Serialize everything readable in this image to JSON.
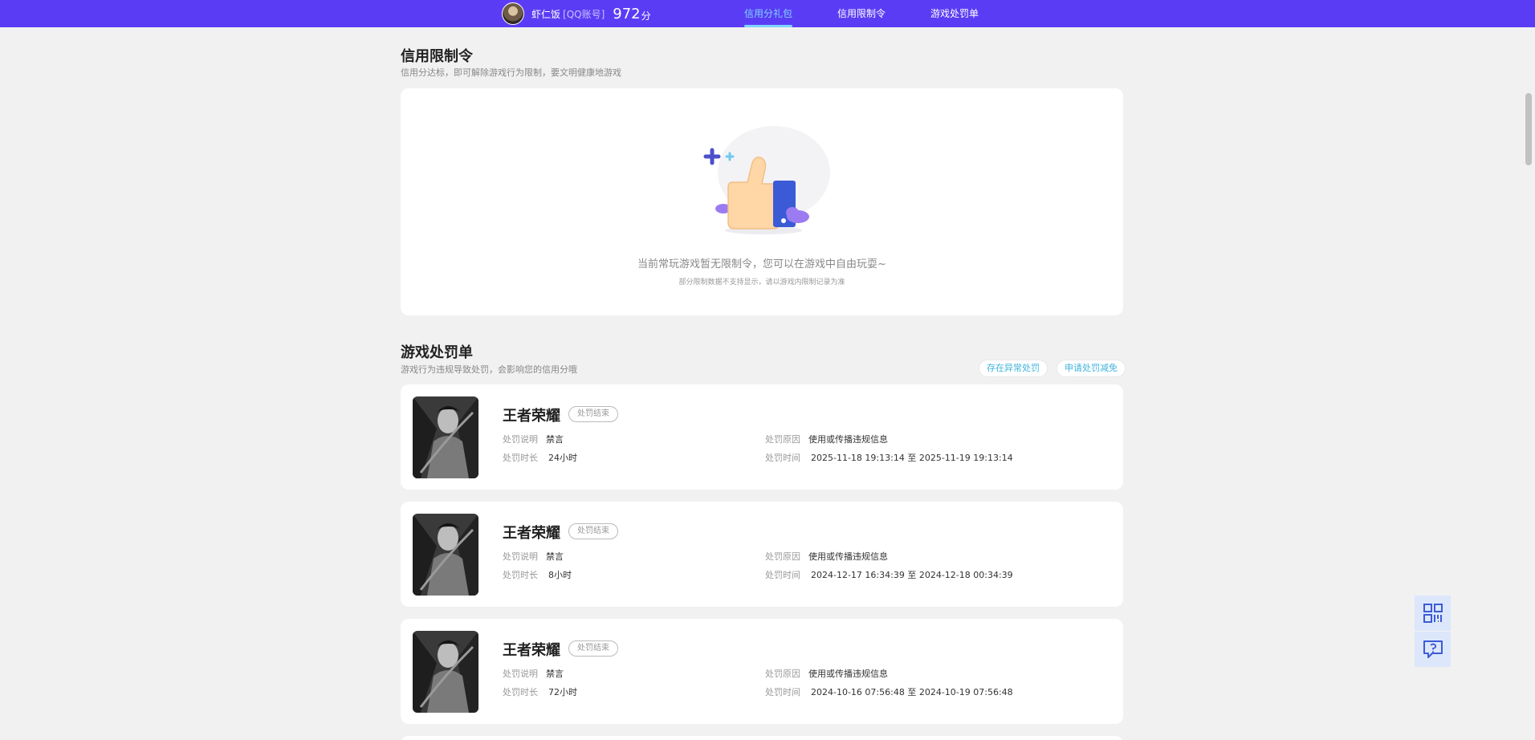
{
  "header": {
    "user_name": "虾仁饭",
    "account_type": "[QQ账号]",
    "score": "972",
    "score_unit": "分",
    "nav": [
      {
        "label": "信用分礼包",
        "active": true
      },
      {
        "label": "信用限制令",
        "active": false
      },
      {
        "label": "游戏处罚单",
        "active": false
      }
    ]
  },
  "restriction": {
    "title": "信用限制令",
    "subtitle": "信用分达标，即可解除游戏行为限制，要文明健康地游戏",
    "empty_text": "当前常玩游戏暂无限制令，您可以在游戏中自由玩耍~",
    "empty_note": "部分限制数据不支持显示，请以游戏内限制记录为准"
  },
  "penalties": {
    "title": "游戏处罚单",
    "subtitle": "游戏行为违规导致处罚，会影响您的信用分哦",
    "abnormal_button": "存在异常处罚",
    "appeal_button": "申请处罚减免",
    "labels": {
      "desc": "处罚说明",
      "duration": "处罚时长",
      "reason": "处罚原因",
      "time": "处罚时间"
    },
    "items": [
      {
        "game": "王者荣耀",
        "status": "处罚结束",
        "desc": "禁言",
        "duration": "24小时",
        "reason": "使用或传播违规信息",
        "start": "2025-11-18 19:13:14",
        "sep": "至",
        "end": "2025-11-19 19:13:14"
      },
      {
        "game": "王者荣耀",
        "status": "处罚结束",
        "desc": "禁言",
        "duration": "8小时",
        "reason": "使用或传播违规信息",
        "start": "2024-12-17 16:34:39",
        "sep": "至",
        "end": "2024-12-18 00:34:39"
      },
      {
        "game": "王者荣耀",
        "status": "处罚结束",
        "desc": "禁言",
        "duration": "72小时",
        "reason": "使用或传播违规信息",
        "start": "2024-10-16 07:56:48",
        "sep": "至",
        "end": "2024-10-19 07:56:48"
      }
    ]
  },
  "colors": {
    "brand": "#5b3cf5",
    "accent": "#3fb3dd",
    "active_nav": "#7fd4ff"
  },
  "icons": {
    "qrcode": "qrcode-icon",
    "help": "help-chat-icon"
  }
}
